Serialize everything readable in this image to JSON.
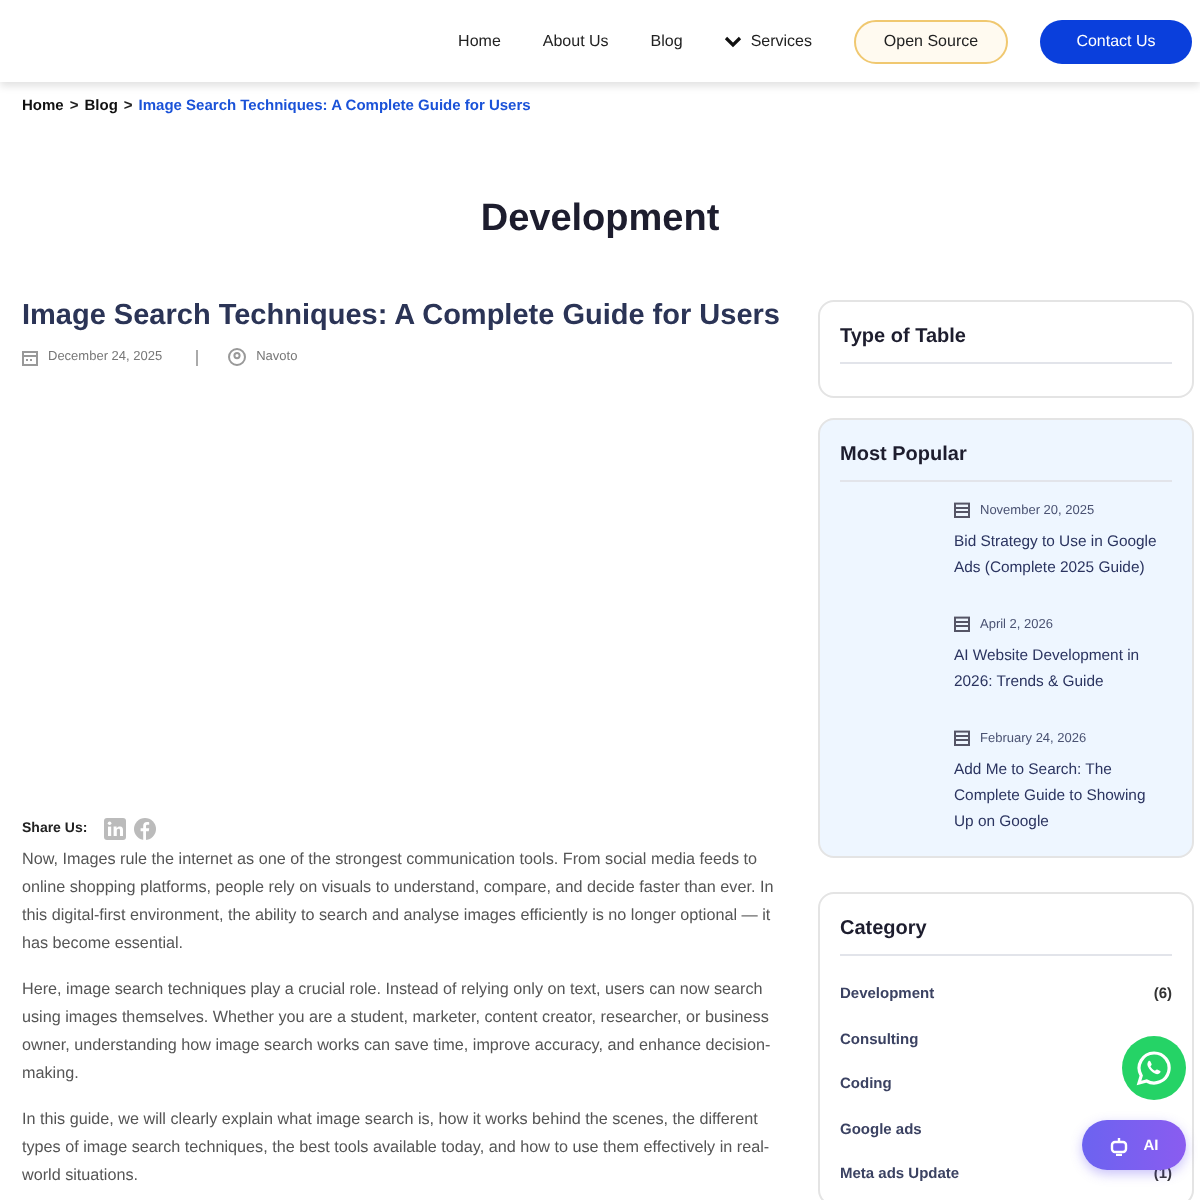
{
  "nav": {
    "links": [
      "Home",
      "About Us",
      "Blog",
      "Services"
    ],
    "outline_button": "Open Source",
    "primary_button": "Contact Us"
  },
  "breadcrumb": {
    "items": [
      "Home",
      "Blog"
    ],
    "separator": ">",
    "current": "Image Search Techniques: A Complete Guide for Users"
  },
  "page_title": "Development",
  "article": {
    "title": "Image Search Techniques: A Complete Guide for Users",
    "date": "December 24, 2025",
    "author": "Navoto",
    "share_label": "Share Us:",
    "paragraphs": [
      "Now, Images rule the internet as one of the strongest communication tools. From social media feeds to online shopping platforms, people rely on visuals to understand, compare, and decide faster than ever. In this digital-first environment, the ability to search and analyse images efficiently is no longer optional — it has become essential.",
      "Here, image search techniques play a crucial role. Instead of relying only on text, users can now search using images themselves. Whether you are a student, marketer, content creator, researcher, or business owner, understanding how image search works can save time, improve accuracy, and enhance decision-making.",
      "In this guide, we will clearly explain what image search is, how it works behind the scenes, the different types of image search techniques, the best tools available today, and how to use them effectively in real-world situations."
    ]
  },
  "sidebar": {
    "toc_title": "Type of Table",
    "popular_title": "Most Popular",
    "popular": [
      {
        "date": "November 20, 2025",
        "title": "Bid Strategy to Use in Google Ads (Complete 2025 Guide)"
      },
      {
        "date": "April 2, 2026",
        "title": "AI Website Development in 2026: Trends & Guide"
      },
      {
        "date": "February 24, 2026",
        "title": "Add Me to Search: The Complete Guide to Showing Up on Google"
      }
    ],
    "category_title": "Category",
    "categories": [
      {
        "name": "Development",
        "count": "(6)"
      },
      {
        "name": "Consulting"
      },
      {
        "name": "Coding"
      },
      {
        "name": "Google ads"
      },
      {
        "name": "Meta ads Update",
        "count": "(1)"
      }
    ]
  },
  "ai_button": "AI"
}
